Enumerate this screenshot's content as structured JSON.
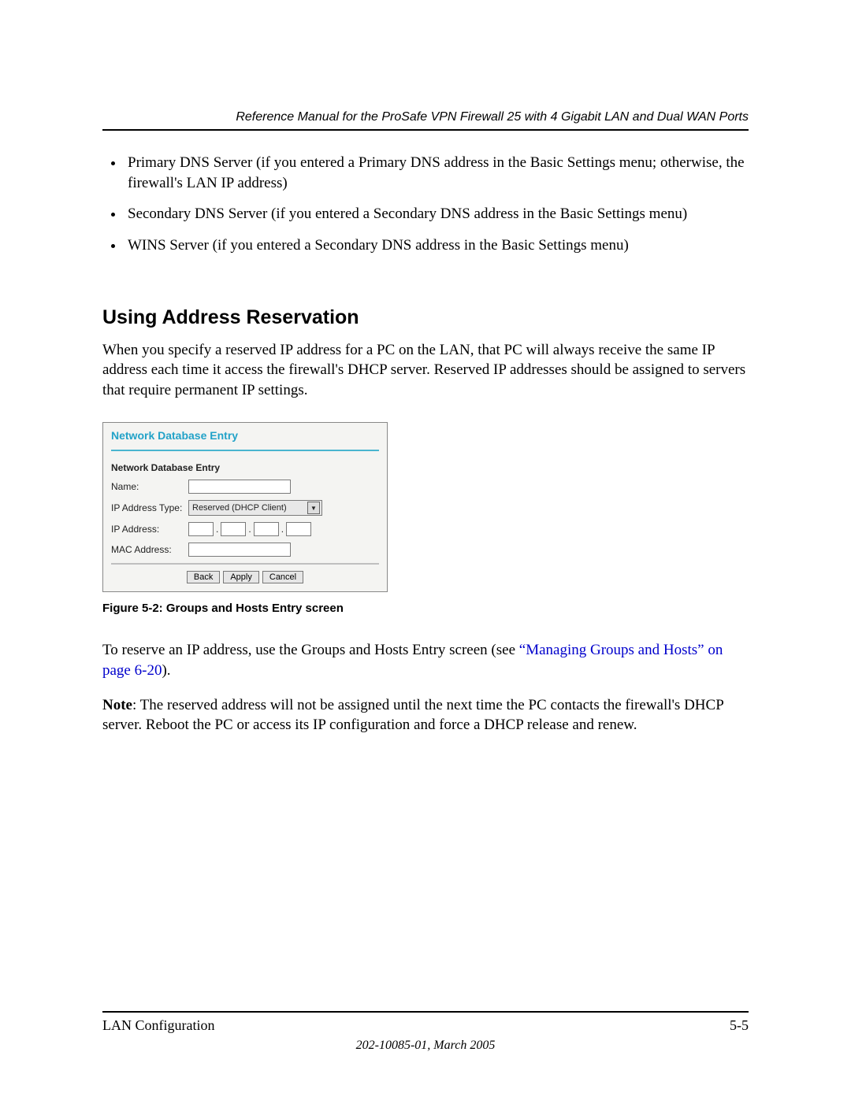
{
  "header": {
    "running_title": "Reference Manual for the ProSafe VPN Firewall 25 with 4 Gigabit LAN and Dual WAN Ports"
  },
  "bullets": [
    "Primary DNS Server (if you entered a Primary DNS address in the Basic Settings menu; otherwise, the firewall's LAN IP address)",
    "Secondary DNS Server (if you entered a Secondary DNS address in the Basic Settings menu)",
    "WINS Server (if you entered a Secondary DNS address in the Basic Settings menu)"
  ],
  "section_heading": "Using Address Reservation",
  "intro_paragraph": "When you specify a reserved IP address for a PC on the LAN, that PC will always receive the same IP address each time it access the firewall's DHCP server. Reserved IP addresses should be assigned to servers that require permanent IP settings.",
  "screenshot": {
    "panel_title": "Network Database Entry",
    "sub_heading": "Network Database Entry",
    "rows": {
      "name_label": "Name:",
      "ip_type_label": "IP Address Type:",
      "ip_type_value": "Reserved (DHCP Client)",
      "ip_addr_label": "IP Address:",
      "mac_label": "MAC Address:"
    },
    "buttons": {
      "back": "Back",
      "apply": "Apply",
      "cancel": "Cancel"
    }
  },
  "figure_caption": "Figure 5-2:  Groups and Hosts Entry screen",
  "reserve_para_pre": "To reserve an IP address, use the Groups and Hosts Entry screen (see ",
  "reserve_link": "“Managing Groups and Hosts” on page 6-20",
  "reserve_para_post": ").",
  "note_label": "Note",
  "note_body": ": The reserved address will not be assigned until the next time the PC contacts the firewall's DHCP server. Reboot the PC or access its IP configuration and force a DHCP release and renew.",
  "footer": {
    "left": "LAN Configuration",
    "right": "5-5",
    "bottom": "202-10085-01, March 2005"
  }
}
